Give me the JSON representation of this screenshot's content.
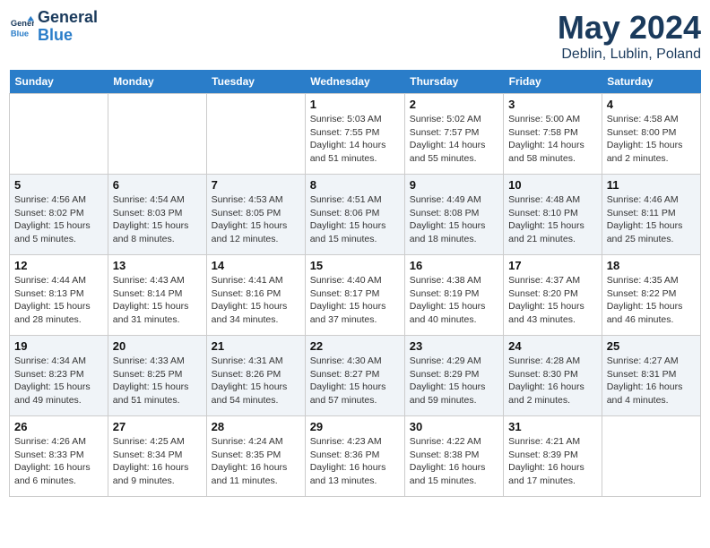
{
  "logo": {
    "line1": "General",
    "line2": "Blue"
  },
  "title": "May 2024",
  "location": "Deblin, Lublin, Poland",
  "days_of_week": [
    "Sunday",
    "Monday",
    "Tuesday",
    "Wednesday",
    "Thursday",
    "Friday",
    "Saturday"
  ],
  "weeks": [
    [
      {
        "day": "",
        "info": ""
      },
      {
        "day": "",
        "info": ""
      },
      {
        "day": "",
        "info": ""
      },
      {
        "day": "1",
        "info": "Sunrise: 5:03 AM\nSunset: 7:55 PM\nDaylight: 14 hours\nand 51 minutes."
      },
      {
        "day": "2",
        "info": "Sunrise: 5:02 AM\nSunset: 7:57 PM\nDaylight: 14 hours\nand 55 minutes."
      },
      {
        "day": "3",
        "info": "Sunrise: 5:00 AM\nSunset: 7:58 PM\nDaylight: 14 hours\nand 58 minutes."
      },
      {
        "day": "4",
        "info": "Sunrise: 4:58 AM\nSunset: 8:00 PM\nDaylight: 15 hours\nand 2 minutes."
      }
    ],
    [
      {
        "day": "5",
        "info": "Sunrise: 4:56 AM\nSunset: 8:02 PM\nDaylight: 15 hours\nand 5 minutes."
      },
      {
        "day": "6",
        "info": "Sunrise: 4:54 AM\nSunset: 8:03 PM\nDaylight: 15 hours\nand 8 minutes."
      },
      {
        "day": "7",
        "info": "Sunrise: 4:53 AM\nSunset: 8:05 PM\nDaylight: 15 hours\nand 12 minutes."
      },
      {
        "day": "8",
        "info": "Sunrise: 4:51 AM\nSunset: 8:06 PM\nDaylight: 15 hours\nand 15 minutes."
      },
      {
        "day": "9",
        "info": "Sunrise: 4:49 AM\nSunset: 8:08 PM\nDaylight: 15 hours\nand 18 minutes."
      },
      {
        "day": "10",
        "info": "Sunrise: 4:48 AM\nSunset: 8:10 PM\nDaylight: 15 hours\nand 21 minutes."
      },
      {
        "day": "11",
        "info": "Sunrise: 4:46 AM\nSunset: 8:11 PM\nDaylight: 15 hours\nand 25 minutes."
      }
    ],
    [
      {
        "day": "12",
        "info": "Sunrise: 4:44 AM\nSunset: 8:13 PM\nDaylight: 15 hours\nand 28 minutes."
      },
      {
        "day": "13",
        "info": "Sunrise: 4:43 AM\nSunset: 8:14 PM\nDaylight: 15 hours\nand 31 minutes."
      },
      {
        "day": "14",
        "info": "Sunrise: 4:41 AM\nSunset: 8:16 PM\nDaylight: 15 hours\nand 34 minutes."
      },
      {
        "day": "15",
        "info": "Sunrise: 4:40 AM\nSunset: 8:17 PM\nDaylight: 15 hours\nand 37 minutes."
      },
      {
        "day": "16",
        "info": "Sunrise: 4:38 AM\nSunset: 8:19 PM\nDaylight: 15 hours\nand 40 minutes."
      },
      {
        "day": "17",
        "info": "Sunrise: 4:37 AM\nSunset: 8:20 PM\nDaylight: 15 hours\nand 43 minutes."
      },
      {
        "day": "18",
        "info": "Sunrise: 4:35 AM\nSunset: 8:22 PM\nDaylight: 15 hours\nand 46 minutes."
      }
    ],
    [
      {
        "day": "19",
        "info": "Sunrise: 4:34 AM\nSunset: 8:23 PM\nDaylight: 15 hours\nand 49 minutes."
      },
      {
        "day": "20",
        "info": "Sunrise: 4:33 AM\nSunset: 8:25 PM\nDaylight: 15 hours\nand 51 minutes."
      },
      {
        "day": "21",
        "info": "Sunrise: 4:31 AM\nSunset: 8:26 PM\nDaylight: 15 hours\nand 54 minutes."
      },
      {
        "day": "22",
        "info": "Sunrise: 4:30 AM\nSunset: 8:27 PM\nDaylight: 15 hours\nand 57 minutes."
      },
      {
        "day": "23",
        "info": "Sunrise: 4:29 AM\nSunset: 8:29 PM\nDaylight: 15 hours\nand 59 minutes."
      },
      {
        "day": "24",
        "info": "Sunrise: 4:28 AM\nSunset: 8:30 PM\nDaylight: 16 hours\nand 2 minutes."
      },
      {
        "day": "25",
        "info": "Sunrise: 4:27 AM\nSunset: 8:31 PM\nDaylight: 16 hours\nand 4 minutes."
      }
    ],
    [
      {
        "day": "26",
        "info": "Sunrise: 4:26 AM\nSunset: 8:33 PM\nDaylight: 16 hours\nand 6 minutes."
      },
      {
        "day": "27",
        "info": "Sunrise: 4:25 AM\nSunset: 8:34 PM\nDaylight: 16 hours\nand 9 minutes."
      },
      {
        "day": "28",
        "info": "Sunrise: 4:24 AM\nSunset: 8:35 PM\nDaylight: 16 hours\nand 11 minutes."
      },
      {
        "day": "29",
        "info": "Sunrise: 4:23 AM\nSunset: 8:36 PM\nDaylight: 16 hours\nand 13 minutes."
      },
      {
        "day": "30",
        "info": "Sunrise: 4:22 AM\nSunset: 8:38 PM\nDaylight: 16 hours\nand 15 minutes."
      },
      {
        "day": "31",
        "info": "Sunrise: 4:21 AM\nSunset: 8:39 PM\nDaylight: 16 hours\nand 17 minutes."
      },
      {
        "day": "",
        "info": ""
      }
    ]
  ]
}
